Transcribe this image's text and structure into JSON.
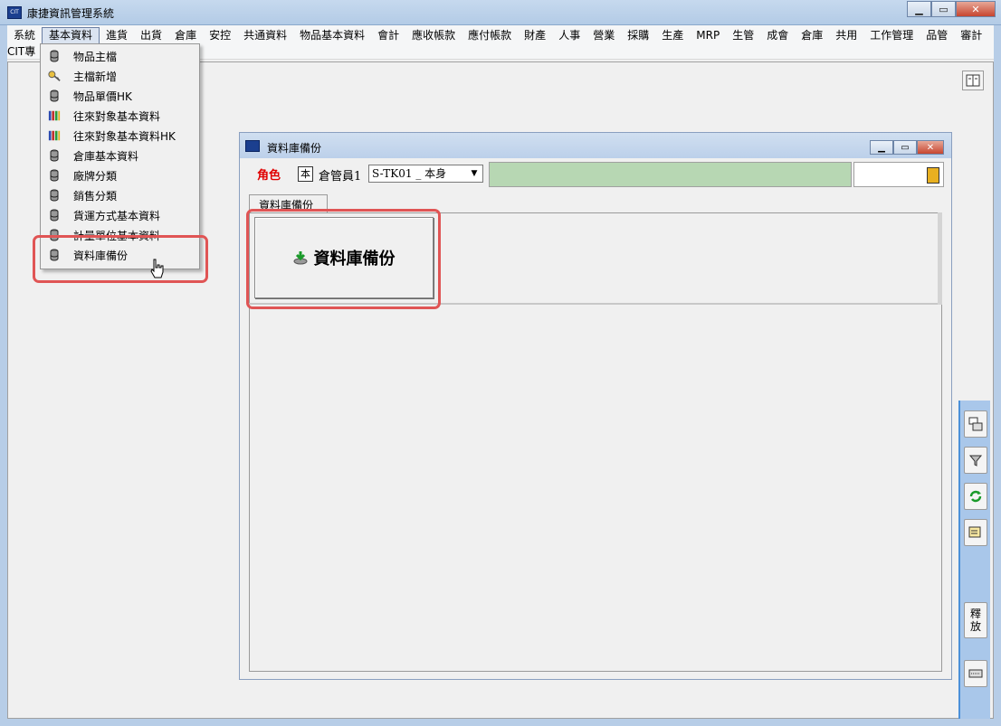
{
  "window": {
    "title": "康捷資訊管理系統",
    "app_icon_text": "CIT"
  },
  "menubar": {
    "row1": [
      "系統",
      "基本資料",
      "進貨",
      "出貨",
      "倉庫",
      "安控",
      "共通資料",
      "物品基本資料",
      "會計",
      "應收帳款",
      "應付帳款",
      "財產",
      "人事",
      "營業",
      "採購",
      "生產",
      "MRP",
      "生管",
      "成會",
      "倉庫",
      "共用",
      "工作管理",
      "品管",
      "審計"
    ],
    "row2": [
      "CIT專"
    ],
    "active_index": 1
  },
  "dropdown": {
    "items": [
      {
        "label": "物品主檔",
        "icon": "database-icon"
      },
      {
        "label": "主檔新增",
        "icon": "keys-icon"
      },
      {
        "label": "物品單價HK",
        "icon": "database-icon"
      },
      {
        "label": "往來對象基本資料",
        "icon": "books-icon"
      },
      {
        "label": "往來對象基本資料HK",
        "icon": "books-icon"
      },
      {
        "label": "倉庫基本資料",
        "icon": "database-icon"
      },
      {
        "label": "廠牌分類",
        "icon": "database-icon"
      },
      {
        "label": "銷售分類",
        "icon": "database-icon"
      },
      {
        "label": "貨運方式基本資料",
        "icon": "database-icon"
      },
      {
        "label": "計量單位基本資料",
        "icon": "database-icon"
      },
      {
        "label": "資料庫備份",
        "icon": "database-icon"
      }
    ],
    "highlighted_index": 10
  },
  "child_window": {
    "title": "資料庫備份",
    "role_label": "角色",
    "role_badge": "本",
    "role_name": "倉管員1",
    "role_select_value": "S-TK01 _ 本身",
    "tab_label": "資料庫備份",
    "backup_button_label": "資料庫備份"
  },
  "right_toolbar": {
    "release_label_1": "釋",
    "release_label_2": "放"
  },
  "colors": {
    "highlight_red": "#e05555",
    "role_red": "#e00000",
    "status_green": "#b7d7b3",
    "toolbar_blue": "#a9c7ea"
  }
}
